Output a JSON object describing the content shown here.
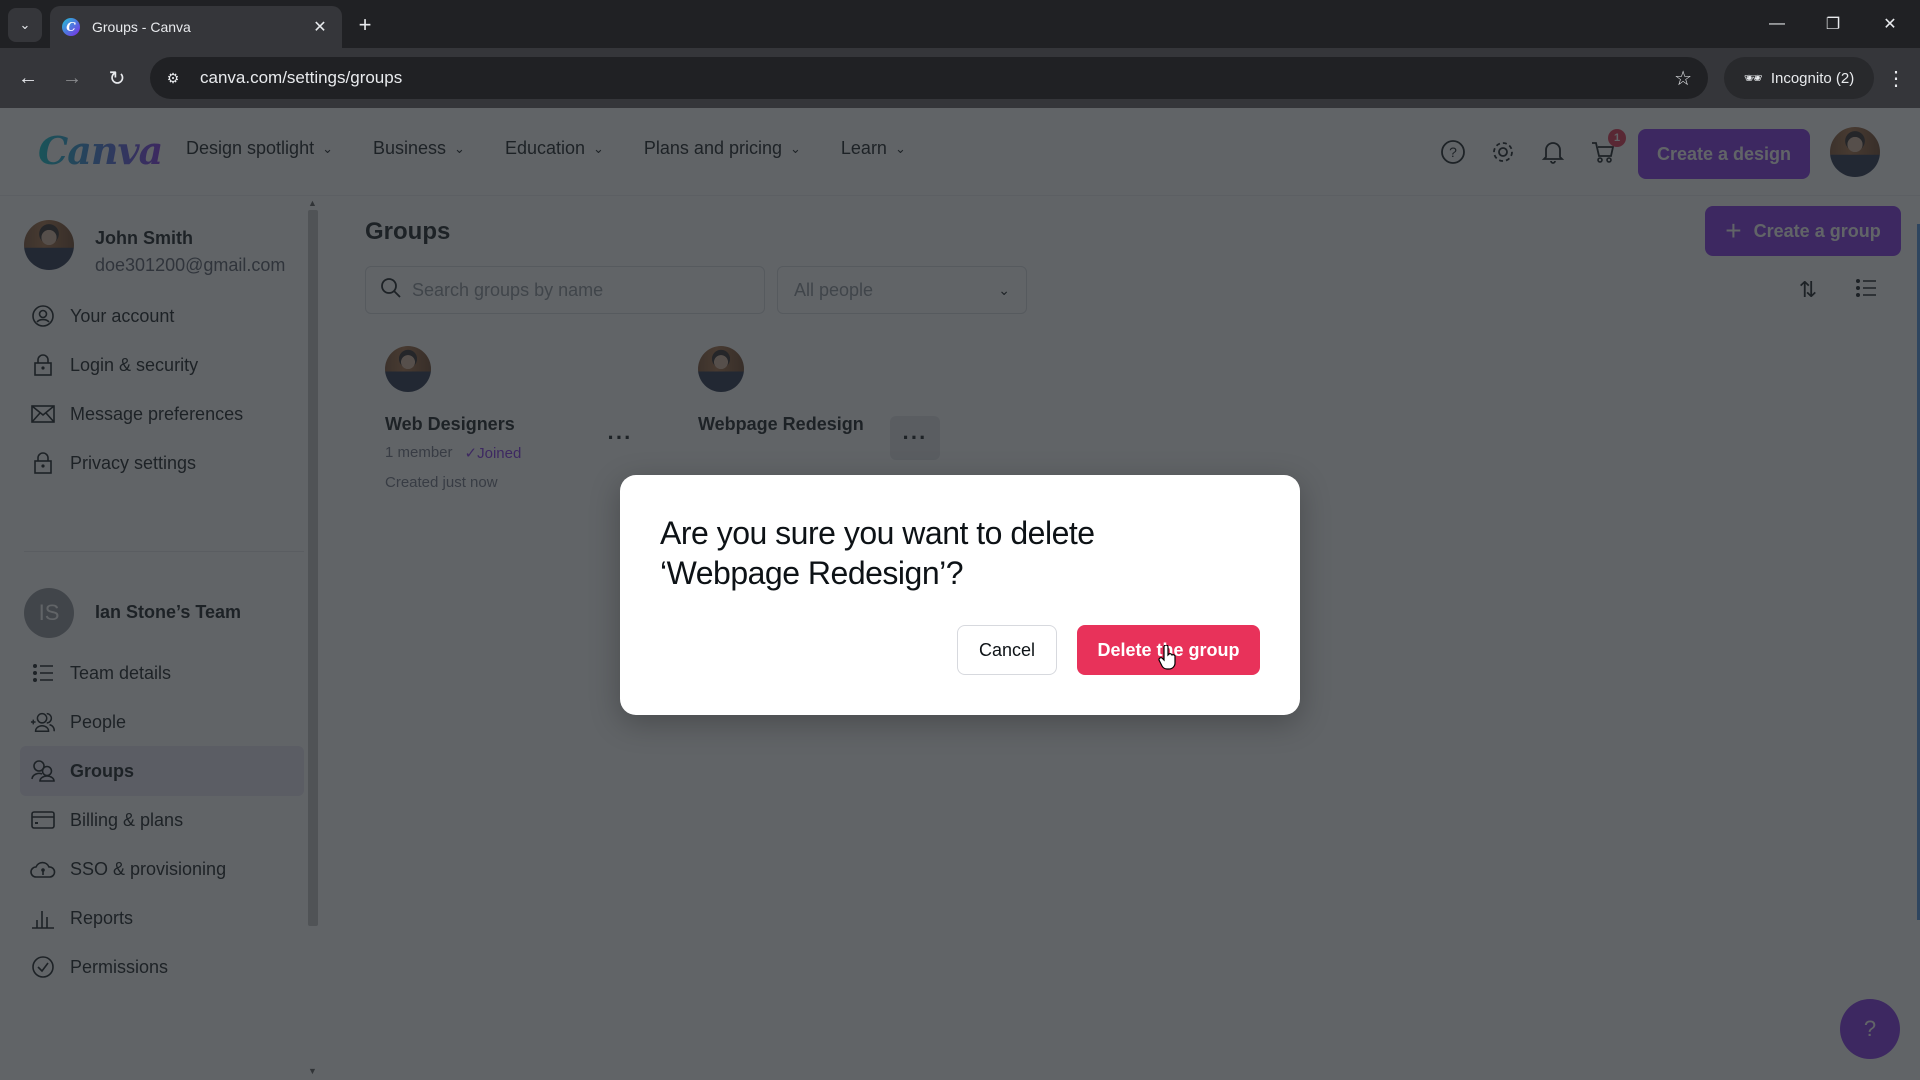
{
  "browser": {
    "tab_title": "Groups - Canva",
    "url": "canva.com/settings/groups",
    "incognito_label": "Incognito (2)"
  },
  "header": {
    "logo": "Canva",
    "nav": [
      {
        "label": "Design spotlight"
      },
      {
        "label": "Business"
      },
      {
        "label": "Education"
      },
      {
        "label": "Plans and pricing"
      },
      {
        "label": "Learn"
      }
    ],
    "cart_count": "1",
    "create_design_label": "Create a design"
  },
  "sidebar": {
    "user": {
      "name": "John Smith",
      "email": "doe301200@gmail.com"
    },
    "account_items": [
      {
        "label": "Your account",
        "icon": "user-circle-icon"
      },
      {
        "label": "Login & security",
        "icon": "lock-icon"
      },
      {
        "label": "Message preferences",
        "icon": "envelope-icon"
      },
      {
        "label": "Privacy settings",
        "icon": "lock-icon"
      }
    ],
    "team": {
      "initials": "IS",
      "name": "Ian Stone’s Team"
    },
    "team_items": [
      {
        "label": "Team details",
        "icon": "list-icon"
      },
      {
        "label": "People",
        "icon": "add-people-icon"
      },
      {
        "label": "Groups",
        "icon": "groups-icon",
        "active": true
      },
      {
        "label": "Billing & plans",
        "icon": "credit-card-icon"
      },
      {
        "label": "SSO & provisioning",
        "icon": "cloud-lock-icon"
      },
      {
        "label": "Reports",
        "icon": "bar-chart-icon"
      },
      {
        "label": "Permissions",
        "icon": "check-circle-icon"
      }
    ]
  },
  "main": {
    "title": "Groups",
    "create_group_label": "Create a group",
    "search_placeholder": "Search groups by name",
    "filter_value": "All people",
    "groups": [
      {
        "name": "Web Designers",
        "members": "1 member",
        "status": "Joined",
        "created": "Created just now"
      },
      {
        "name": "Webpage Redesign"
      }
    ]
  },
  "modal": {
    "title": "Are you sure you want to delete ‘Webpage Redesign’?",
    "cancel_label": "Cancel",
    "delete_label": "Delete the group"
  },
  "help_fab_label": "?"
}
